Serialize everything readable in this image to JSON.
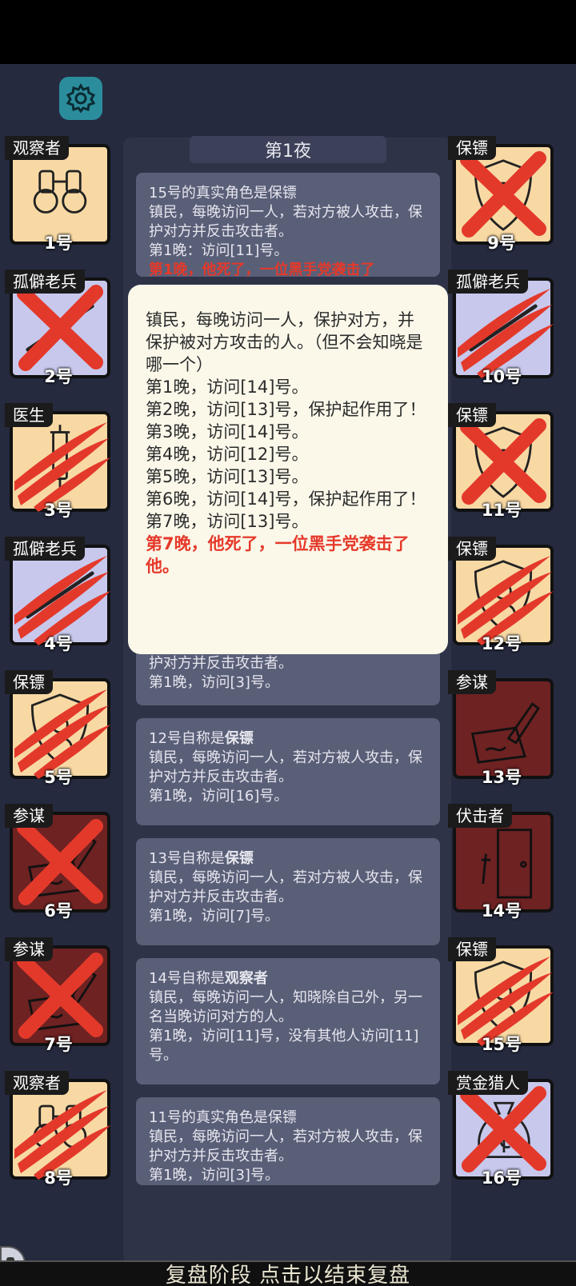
{
  "night_title": "第1夜",
  "cards": [
    {
      "lines": [
        "15号的真实角色是保镖",
        "镇民，每晚访问一人，若对方被人攻击，保护对方并反击攻击者。",
        "第1晚：访问[11]号。"
      ],
      "red": "第1晚，他死了，一位黑手党袭击了"
    },
    {
      "lines": [
        "镇民，每晚访问一人，若对方被人攻击，保护对方并反击攻击者。",
        "第1晚，访问[3]号。"
      ]
    },
    {
      "prefix": "12号自称是",
      "role": "保镖",
      "lines": [
        "镇民，每晚访问一人，若对方被人攻击，保护对方并反击攻击者。",
        "第1晚，访问[16]号。"
      ]
    },
    {
      "prefix": "13号自称是",
      "role": "保镖",
      "lines": [
        "镇民，每晚访问一人，若对方被人攻击，保护对方并反击攻击者。",
        "第1晚，访问[7]号。"
      ]
    },
    {
      "prefix": "14号自称是",
      "role": "观察者",
      "lines": [
        "镇民，每晚访问一人，知晓除自己外，另一名当晚访问对方的人。",
        "第1晚，访问[11]号，没有其他人访问[11]号。"
      ]
    },
    {
      "lines": [
        "11号的真实角色是保镖",
        "镇民，每晚访问一人，若对方被人攻击，保护对方并反击攻击者。",
        "第1晚，访问[3]号。"
      ]
    }
  ],
  "popup": {
    "lines": [
      "镇民，每晚访问一人，保护对方，并保护被对方攻击的人。（但不会知晓是哪一个）",
      "第1晚，访问[14]号。",
      "第2晚，访问[13]号，保护起作用了！",
      "第3晚，访问[14]号。",
      "第4晚，访问[12]号。",
      "第5晚，访问[13]号。",
      "第6晚，访问[14]号，保护起作用了！",
      "第7晚，访问[13]号。"
    ],
    "red": "第7晚，他死了，一位黑手党袭击了他。"
  },
  "players_left": [
    {
      "role": "观察者",
      "num": "1号",
      "art": "binoculars",
      "bg": "peach",
      "state": "alive"
    },
    {
      "role": "孤僻老兵",
      "num": "2号",
      "art": "rifle",
      "bg": "lav",
      "state": "x"
    },
    {
      "role": "医生",
      "num": "3号",
      "art": "syringe",
      "bg": "peach",
      "state": "claw"
    },
    {
      "role": "孤僻老兵",
      "num": "4号",
      "art": "rifle",
      "bg": "lav",
      "state": "claw"
    },
    {
      "role": "保镖",
      "num": "5号",
      "art": "shield",
      "bg": "peach",
      "state": "claw"
    },
    {
      "role": "参谋",
      "num": "6号",
      "art": "pen",
      "bg": "maroon",
      "state": "x"
    },
    {
      "role": "参谋",
      "num": "7号",
      "art": "pen",
      "bg": "maroon",
      "state": "x"
    },
    {
      "role": "观察者",
      "num": "8号",
      "art": "binoculars",
      "bg": "peach",
      "state": "claw"
    }
  ],
  "players_right": [
    {
      "role": "保镖",
      "num": "9号",
      "art": "shield",
      "bg": "peach",
      "state": "x"
    },
    {
      "role": "孤僻老兵",
      "num": "10号",
      "art": "rifle",
      "bg": "lav",
      "state": "claw"
    },
    {
      "role": "保镖",
      "num": "11号",
      "art": "shield",
      "bg": "peach",
      "state": "x"
    },
    {
      "role": "保镖",
      "num": "12号",
      "art": "shield",
      "bg": "peach",
      "state": "claw"
    },
    {
      "role": "参谋",
      "num": "13号",
      "art": "pen",
      "bg": "maroon",
      "state": "alive"
    },
    {
      "role": "伏击者",
      "num": "14号",
      "art": "door",
      "bg": "maroon",
      "state": "alive"
    },
    {
      "role": "保镖",
      "num": "15号",
      "art": "shield",
      "bg": "peach",
      "state": "claw"
    },
    {
      "role": "赏金猎人",
      "num": "16号",
      "art": "moneybag",
      "bg": "lav",
      "state": "x"
    }
  ],
  "bottom_bar": "复盘阶段 点击以结束复盘",
  "icons": {
    "settings": "gear-icon"
  },
  "colors": {
    "accent_red": "#e5392a",
    "gear_bg": "#2b8d9c",
    "background": "#252a3f"
  }
}
